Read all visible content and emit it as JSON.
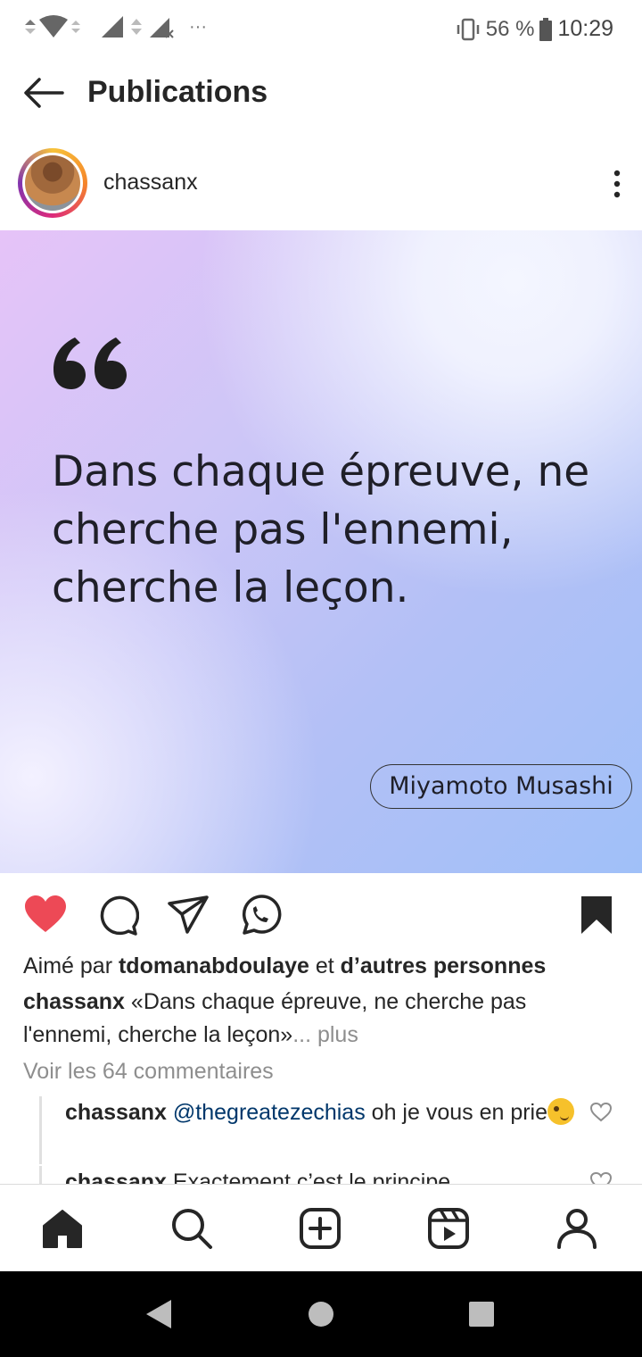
{
  "status_bar": {
    "battery_percent": "56 %",
    "time": "10:29",
    "more_indicator": "···"
  },
  "header": {
    "title": "Publications"
  },
  "post": {
    "username": "chassanx",
    "image": {
      "quote_mark": "“",
      "quote_text": "Dans chaque épreuve, ne cherche pas l'ennemi, cherche la leçon.",
      "author": "Miyamoto Musashi"
    },
    "liked": true,
    "likes": {
      "prefix": "Aimé par ",
      "user": "tdomanabdoulaye",
      "middle": " et ",
      "suffix": "d’autres personnes"
    },
    "caption": {
      "user": "chassanx",
      "text": " «Dans chaque épreuve, ne cherche pas l'ennemi, cherche la leçon»",
      "more": "... plus"
    },
    "view_comments": "Voir les 64 commentaires",
    "comments": [
      {
        "user": "chassanx",
        "mention": "@thegreatezechias",
        "text": " oh je vous en prie"
      },
      {
        "user": "chassanx",
        "mention": "",
        "text": " Exactement c’est le principe"
      }
    ]
  },
  "colors": {
    "like_red": "#ed4956",
    "text": "#262626",
    "muted": "#8e8e8e",
    "mention": "#00376b"
  },
  "icons": [
    "back-arrow-icon",
    "more-vertical-icon",
    "heart-icon",
    "comment-icon",
    "share-icon",
    "whatsapp-icon",
    "bookmark-icon",
    "home-icon",
    "search-icon",
    "add-post-icon",
    "reels-icon",
    "profile-icon"
  ]
}
